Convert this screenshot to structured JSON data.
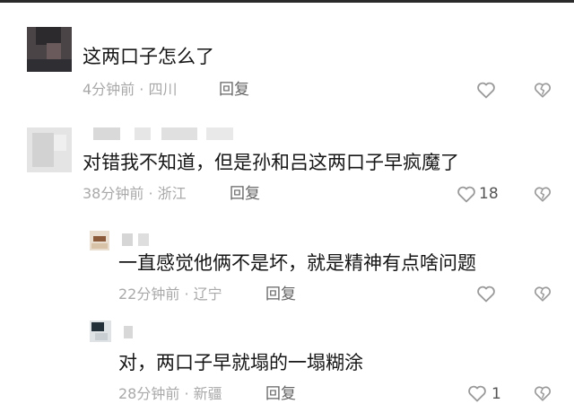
{
  "comments": [
    {
      "text": "这两口子怎么了",
      "time": "4分钟前",
      "location": "四川",
      "reply": "回复",
      "likes": ""
    },
    {
      "text": "对错我不知道，但是孙和吕这两口子早疯魔了",
      "time": "38分钟前",
      "location": "浙江",
      "reply": "回复",
      "likes": "18"
    }
  ],
  "replies": [
    {
      "text": "一直感觉他俩不是坏，就是精神有点啥问题",
      "time": "22分钟前",
      "location": "辽宁",
      "reply": "回复",
      "likes": ""
    },
    {
      "text": "对，两口子早就塌的一塌糊涂",
      "time": "28分钟前",
      "location": "新疆",
      "reply": "回复",
      "likes": "1"
    }
  ],
  "separator": "·",
  "icons": {
    "like": "heart-outline-icon",
    "dislike": "broken-heart-icon"
  },
  "colors": {
    "meta": "#a9a9a9",
    "text": "#161616",
    "icon": "#9a9a9a"
  }
}
